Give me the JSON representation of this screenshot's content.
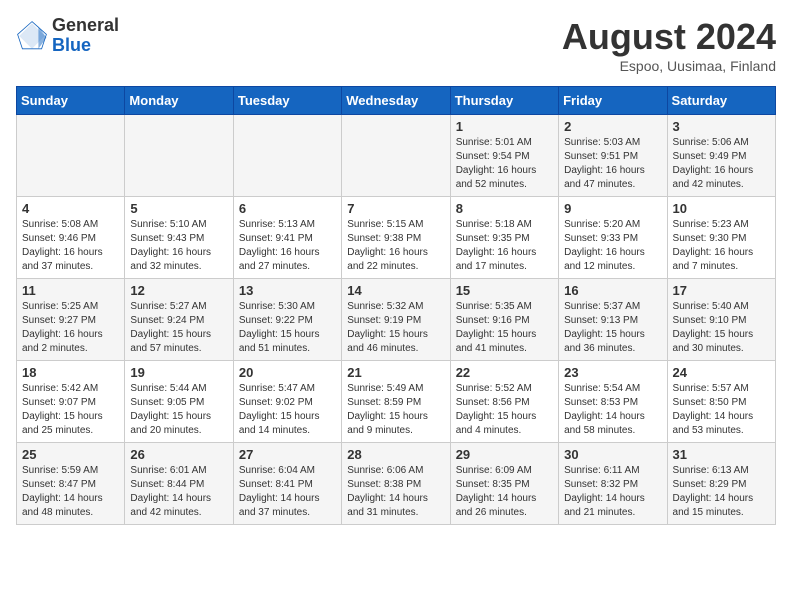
{
  "header": {
    "logo_general": "General",
    "logo_blue": "Blue",
    "month_title": "August 2024",
    "location": "Espoo, Uusimaa, Finland"
  },
  "days_of_week": [
    "Sunday",
    "Monday",
    "Tuesday",
    "Wednesday",
    "Thursday",
    "Friday",
    "Saturday"
  ],
  "weeks": [
    [
      {
        "day": "",
        "info": ""
      },
      {
        "day": "",
        "info": ""
      },
      {
        "day": "",
        "info": ""
      },
      {
        "day": "",
        "info": ""
      },
      {
        "day": "1",
        "info": "Sunrise: 5:01 AM\nSunset: 9:54 PM\nDaylight: 16 hours\nand 52 minutes."
      },
      {
        "day": "2",
        "info": "Sunrise: 5:03 AM\nSunset: 9:51 PM\nDaylight: 16 hours\nand 47 minutes."
      },
      {
        "day": "3",
        "info": "Sunrise: 5:06 AM\nSunset: 9:49 PM\nDaylight: 16 hours\nand 42 minutes."
      }
    ],
    [
      {
        "day": "4",
        "info": "Sunrise: 5:08 AM\nSunset: 9:46 PM\nDaylight: 16 hours\nand 37 minutes."
      },
      {
        "day": "5",
        "info": "Sunrise: 5:10 AM\nSunset: 9:43 PM\nDaylight: 16 hours\nand 32 minutes."
      },
      {
        "day": "6",
        "info": "Sunrise: 5:13 AM\nSunset: 9:41 PM\nDaylight: 16 hours\nand 27 minutes."
      },
      {
        "day": "7",
        "info": "Sunrise: 5:15 AM\nSunset: 9:38 PM\nDaylight: 16 hours\nand 22 minutes."
      },
      {
        "day": "8",
        "info": "Sunrise: 5:18 AM\nSunset: 9:35 PM\nDaylight: 16 hours\nand 17 minutes."
      },
      {
        "day": "9",
        "info": "Sunrise: 5:20 AM\nSunset: 9:33 PM\nDaylight: 16 hours\nand 12 minutes."
      },
      {
        "day": "10",
        "info": "Sunrise: 5:23 AM\nSunset: 9:30 PM\nDaylight: 16 hours\nand 7 minutes."
      }
    ],
    [
      {
        "day": "11",
        "info": "Sunrise: 5:25 AM\nSunset: 9:27 PM\nDaylight: 16 hours\nand 2 minutes."
      },
      {
        "day": "12",
        "info": "Sunrise: 5:27 AM\nSunset: 9:24 PM\nDaylight: 15 hours\nand 57 minutes."
      },
      {
        "day": "13",
        "info": "Sunrise: 5:30 AM\nSunset: 9:22 PM\nDaylight: 15 hours\nand 51 minutes."
      },
      {
        "day": "14",
        "info": "Sunrise: 5:32 AM\nSunset: 9:19 PM\nDaylight: 15 hours\nand 46 minutes."
      },
      {
        "day": "15",
        "info": "Sunrise: 5:35 AM\nSunset: 9:16 PM\nDaylight: 15 hours\nand 41 minutes."
      },
      {
        "day": "16",
        "info": "Sunrise: 5:37 AM\nSunset: 9:13 PM\nDaylight: 15 hours\nand 36 minutes."
      },
      {
        "day": "17",
        "info": "Sunrise: 5:40 AM\nSunset: 9:10 PM\nDaylight: 15 hours\nand 30 minutes."
      }
    ],
    [
      {
        "day": "18",
        "info": "Sunrise: 5:42 AM\nSunset: 9:07 PM\nDaylight: 15 hours\nand 25 minutes."
      },
      {
        "day": "19",
        "info": "Sunrise: 5:44 AM\nSunset: 9:05 PM\nDaylight: 15 hours\nand 20 minutes."
      },
      {
        "day": "20",
        "info": "Sunrise: 5:47 AM\nSunset: 9:02 PM\nDaylight: 15 hours\nand 14 minutes."
      },
      {
        "day": "21",
        "info": "Sunrise: 5:49 AM\nSunset: 8:59 PM\nDaylight: 15 hours\nand 9 minutes."
      },
      {
        "day": "22",
        "info": "Sunrise: 5:52 AM\nSunset: 8:56 PM\nDaylight: 15 hours\nand 4 minutes."
      },
      {
        "day": "23",
        "info": "Sunrise: 5:54 AM\nSunset: 8:53 PM\nDaylight: 14 hours\nand 58 minutes."
      },
      {
        "day": "24",
        "info": "Sunrise: 5:57 AM\nSunset: 8:50 PM\nDaylight: 14 hours\nand 53 minutes."
      }
    ],
    [
      {
        "day": "25",
        "info": "Sunrise: 5:59 AM\nSunset: 8:47 PM\nDaylight: 14 hours\nand 48 minutes."
      },
      {
        "day": "26",
        "info": "Sunrise: 6:01 AM\nSunset: 8:44 PM\nDaylight: 14 hours\nand 42 minutes."
      },
      {
        "day": "27",
        "info": "Sunrise: 6:04 AM\nSunset: 8:41 PM\nDaylight: 14 hours\nand 37 minutes."
      },
      {
        "day": "28",
        "info": "Sunrise: 6:06 AM\nSunset: 8:38 PM\nDaylight: 14 hours\nand 31 minutes."
      },
      {
        "day": "29",
        "info": "Sunrise: 6:09 AM\nSunset: 8:35 PM\nDaylight: 14 hours\nand 26 minutes."
      },
      {
        "day": "30",
        "info": "Sunrise: 6:11 AM\nSunset: 8:32 PM\nDaylight: 14 hours\nand 21 minutes."
      },
      {
        "day": "31",
        "info": "Sunrise: 6:13 AM\nSunset: 8:29 PM\nDaylight: 14 hours\nand 15 minutes."
      }
    ]
  ]
}
